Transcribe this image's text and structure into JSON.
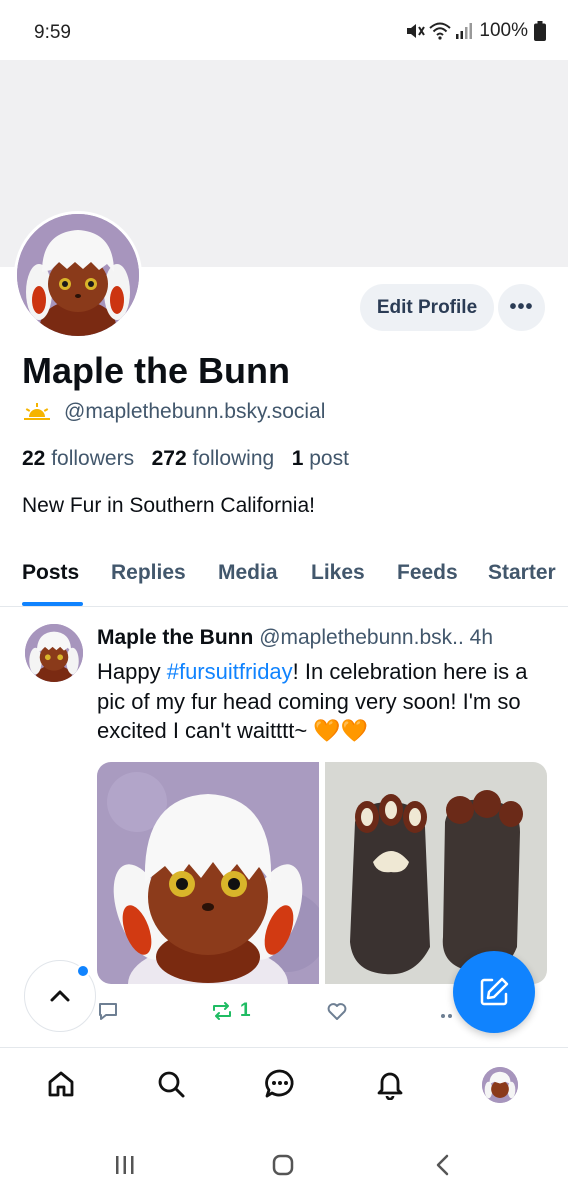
{
  "status_bar": {
    "time": "9:59",
    "battery": "100%"
  },
  "profile": {
    "display_name": "Maple the Bunn",
    "handle": "@maplethebunn.bsky.social",
    "followers_count": "22",
    "followers_label": "followers",
    "following_count": "272",
    "following_label": "following",
    "posts_count": "1",
    "posts_label": "post",
    "bio": "New Fur in Southern California!",
    "edit_button": "Edit Profile",
    "more_button": "•••"
  },
  "tabs": [
    {
      "label": "Posts",
      "active": true
    },
    {
      "label": "Replies",
      "active": false
    },
    {
      "label": "Media",
      "active": false
    },
    {
      "label": "Likes",
      "active": false
    },
    {
      "label": "Feeds",
      "active": false
    },
    {
      "label": "Starter",
      "active": false
    }
  ],
  "post": {
    "author": "Maple the Bunn",
    "handle": "@maplethebunn.bsk..",
    "time": "4h",
    "text_before": "Happy ",
    "hashtag": "#fursuitfriday",
    "text_after": "! In celebration here is a pic of my fur head coming very soon! I'm so excited I can't waitttt~ 🧡🧡",
    "reply_count": "",
    "repost_count": "1",
    "like_count": ""
  },
  "colors": {
    "accent": "#1083fe",
    "repost": "#20bc63",
    "muted": "#42576c"
  },
  "icons": {
    "home": "home-icon",
    "search": "search-icon",
    "chat": "chat-icon",
    "notifications": "bell-icon",
    "compose": "compose-icon"
  }
}
